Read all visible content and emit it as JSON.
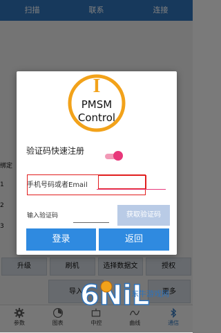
{
  "background": {
    "top_tabs": [
      "扫描",
      "联系",
      "连接"
    ],
    "row_labels": [
      "绑定",
      "1",
      "2",
      "3"
    ],
    "action_buttons": [
      "升级",
      "刷机",
      "选择数据文",
      "授权"
    ],
    "second_row": {
      "import_label": "导入",
      "more_label": "更多"
    },
    "bottom_nav": [
      {
        "label": "参数",
        "icon": "gear-icon"
      },
      {
        "label": "图表",
        "icon": "chart-icon"
      },
      {
        "label": "中控",
        "icon": "control-icon"
      },
      {
        "label": "曲线",
        "icon": "curve-icon"
      },
      {
        "label": "通信",
        "icon": "bluetooth-icon",
        "active": true
      }
    ]
  },
  "dialog": {
    "logo": {
      "line1": "PMSM",
      "line2": "Control",
      "letter": "I"
    },
    "register_label": "验证码快速注册",
    "register_toggle_on": true,
    "phone_placeholder": "手机号码或者Email",
    "phone_value": "",
    "code_label": "输入验证码",
    "code_value": "",
    "get_code_button": "获取验证码",
    "login_button": "登录",
    "back_button": "返回"
  },
  "watermark": {
    "text": "6NiL",
    "sub": "东牛游戏网"
  },
  "colors": {
    "accent_blue": "#2f8ae0",
    "toggle_pink": "#e8377a",
    "highlight_red": "#e11d1d",
    "logo_orange": "#f2a21a"
  }
}
